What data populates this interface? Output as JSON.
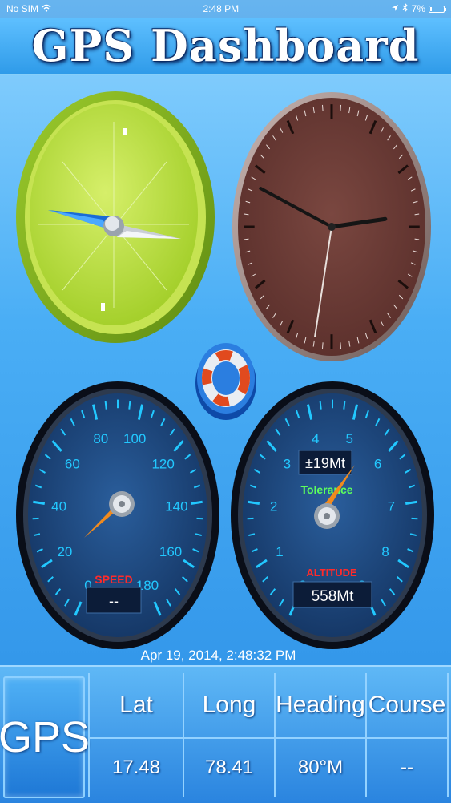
{
  "status_bar": {
    "carrier": "No SIM",
    "time": "2:48 PM",
    "battery": "7%"
  },
  "header": {
    "title": "GPS Dashboard"
  },
  "speedometer": {
    "ticks": [
      "0",
      "20",
      "40",
      "60",
      "80",
      "100",
      "120",
      "140",
      "160",
      "180"
    ],
    "label": "SPEED",
    "readout": "--"
  },
  "altimeter": {
    "ticks": [
      "0",
      "1",
      "2",
      "3",
      "4",
      "5",
      "6",
      "7",
      "8",
      "9"
    ],
    "tolerance_value": "±19Mt",
    "tolerance_label": "Tolerance",
    "label": "ALTITUDE",
    "readout": "558Mt"
  },
  "clock": {
    "hour": 2,
    "minute": 48,
    "second": 32
  },
  "timestamp": "Apr 19, 2014, 2:48:32 PM",
  "info_bar": {
    "gps_button": "GPS",
    "columns": [
      {
        "label": "Lat",
        "value": "17.48"
      },
      {
        "label": "Long",
        "value": "78.41"
      },
      {
        "label": "Heading",
        "value": "80°M"
      },
      {
        "label": "Course",
        "value": "--"
      }
    ]
  },
  "icons": {
    "compass": "compass-icon",
    "lifebuoy": "lifebuoy-icon",
    "wifi": "wifi-icon",
    "location": "location-arrow-icon",
    "bluetooth": "bluetooth-icon"
  },
  "colors": {
    "compass_face": "#b5dc3a",
    "clock_face": "#6b3a34",
    "gauge_face": "#1d4a86",
    "gauge_tick": "#22c8ff",
    "needle": "#f08a1e"
  }
}
